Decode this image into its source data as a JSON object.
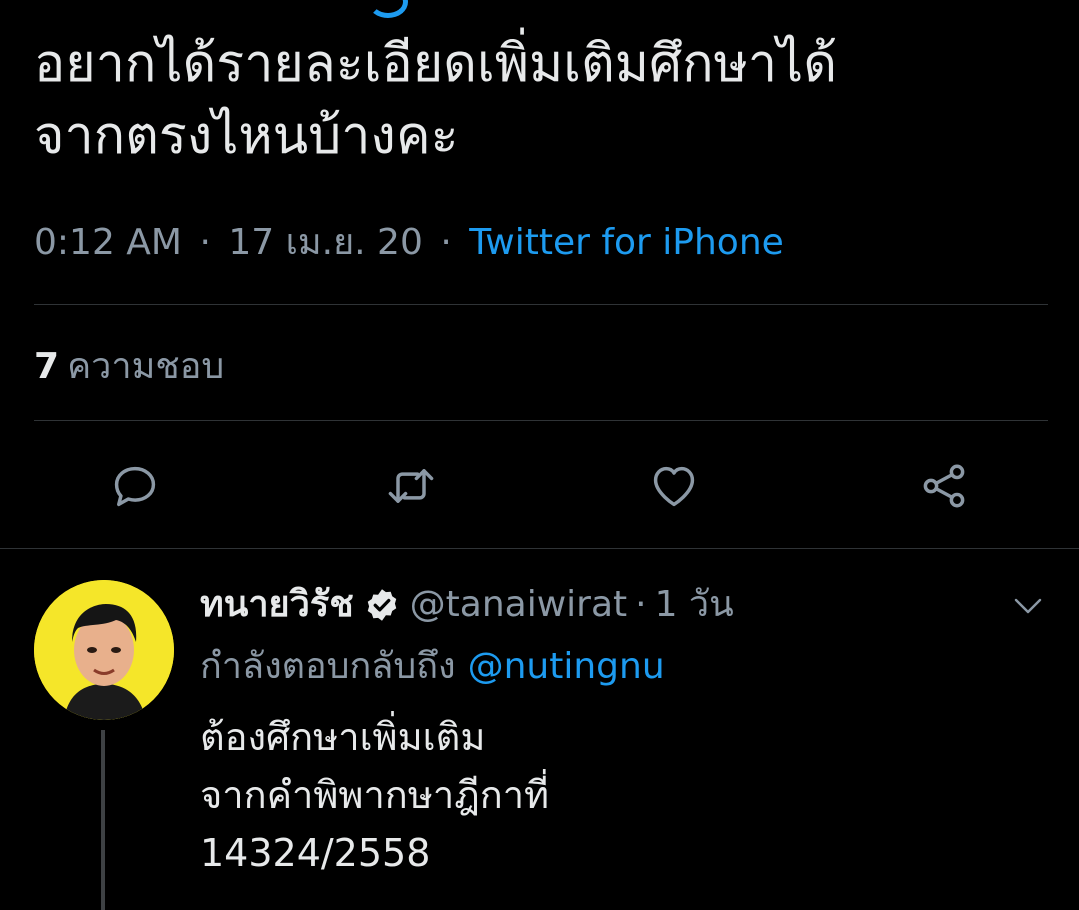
{
  "tweet": {
    "text_lines": [
      "อยากได้รายละเอียดเพิ่มเติมศึกษาได้",
      "จากตรงไหนบ้างคะ"
    ],
    "time": "0:12 AM",
    "date": "17 เม.ย. 20",
    "separator": "·",
    "source": "Twitter for iPhone",
    "likes_count": "7",
    "likes_label": "ความชอบ"
  },
  "actions": {
    "reply_icon": "reply-icon",
    "retweet_icon": "retweet-icon",
    "like_icon": "heart-icon",
    "share_icon": "share-icon"
  },
  "reply": {
    "display_name": "ทนายวิรัช",
    "handle": "@tanaiwirat",
    "separator": "·",
    "time_ago": "1 วัน",
    "replying_label": "กำลังตอบกลับถึง",
    "replying_to": "@nutingnu",
    "text_lines": [
      "ต้องศึกษาเพิ่มเติม",
      "จากคำพิพากษาฎีกาที่",
      "14324/2558"
    ]
  },
  "colors": {
    "background": "#000000",
    "text_primary": "#e7e9ea",
    "text_secondary": "#8b98a5",
    "accent": "#1d9bf0",
    "divider": "#2f3336",
    "avatar_bg": "#f5e629"
  }
}
